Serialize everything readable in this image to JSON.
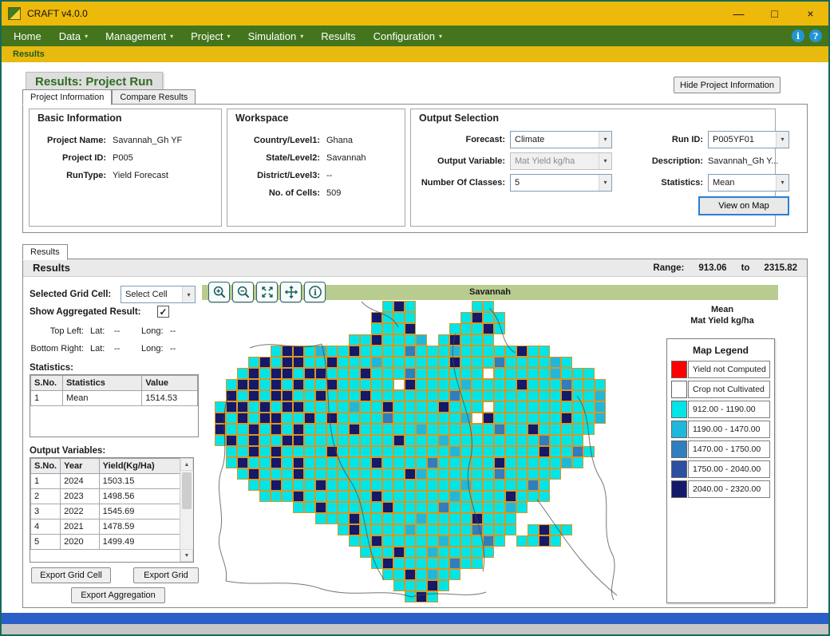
{
  "window": {
    "title": "CRAFT v4.0.0",
    "controls": {
      "minimize": "—",
      "maximize": "□",
      "close": "×"
    }
  },
  "icons": {
    "chevron_down": "▾",
    "scroll_up": "▲",
    "scroll_down": "▼",
    "check": "✓",
    "info": "i",
    "help": "?"
  },
  "menu": {
    "items": [
      {
        "label": "Home",
        "dropdown": false
      },
      {
        "label": "Data",
        "dropdown": true
      },
      {
        "label": "Management",
        "dropdown": true
      },
      {
        "label": "Project",
        "dropdown": true
      },
      {
        "label": "Simulation",
        "dropdown": true
      },
      {
        "label": "Results",
        "dropdown": false
      },
      {
        "label": "Configuration",
        "dropdown": true
      }
    ]
  },
  "breadcrumb": "Results",
  "page": {
    "title": "Results: Project Run",
    "hide_button": "Hide Project Information",
    "tabs": [
      {
        "label": "Project Information",
        "active": true
      },
      {
        "label": "Compare Results",
        "active": false
      }
    ]
  },
  "basic_information": {
    "title": "Basic Information",
    "fields": [
      {
        "label": "Project Name:",
        "value": "Savannah_Gh YF"
      },
      {
        "label": "Project ID:",
        "value": "P005"
      },
      {
        "label": "RunType:",
        "value": "Yield Forecast"
      }
    ]
  },
  "workspace": {
    "title": "Workspace",
    "fields": [
      {
        "label": "Country/Level1:",
        "value": "Ghana"
      },
      {
        "label": "State/Level2:",
        "value": "Savannah"
      },
      {
        "label": "District/Level3:",
        "value": "--"
      },
      {
        "label": "No. of Cells:",
        "value": "509"
      }
    ]
  },
  "output_selection": {
    "title": "Output Selection",
    "forecast_label": "Forecast:",
    "forecast_value": "Climate",
    "output_variable_label": "Output Variable:",
    "output_variable_value": "Mat Yield kg/ha",
    "classes_label": "Number Of Classes:",
    "classes_value": "5",
    "run_id_label": "Run ID:",
    "run_id_value": "P005YF01",
    "description_label": "Description:",
    "description_value": "Savannah_Gh Y...",
    "statistics_label": "Statistics:",
    "statistics_value": "Mean",
    "view_on_map": "View on Map"
  },
  "results": {
    "tab": "Results",
    "header": "Results",
    "range_label": "Range:",
    "range_min": "913.06",
    "range_to": "to",
    "range_max": "2315.82",
    "selected_grid_cell_label": "Selected Grid Cell:",
    "select_cell_value": "Select Cell",
    "toolbar": [
      "zoom-in",
      "zoom-out",
      "zoom-extent",
      "pan",
      "identify"
    ],
    "region_title": "Savannah",
    "aggregated_label": "Show Aggregated Result:",
    "aggregated_checked": true,
    "top_left_label": "Top Left:",
    "bottom_right_label": "Bottom Right:",
    "lat_label": "Lat:",
    "long_label": "Long:",
    "top_left_lat": "--",
    "top_left_long": "--",
    "bottom_right_lat": "--",
    "bottom_right_long": "--",
    "statistics_label": "Statistics:",
    "statistics_table": {
      "headers": [
        "S.No.",
        "Statistics",
        "Value"
      ],
      "rows": [
        [
          "1",
          "Mean",
          "1514.53"
        ]
      ]
    },
    "output_variables_label": "Output Variables:",
    "output_table": {
      "headers": [
        "S.No.",
        "Year",
        "Yield(Kg/Ha)"
      ],
      "rows": [
        [
          "1",
          "2024",
          "1503.15"
        ],
        [
          "2",
          "2023",
          "1498.56"
        ],
        [
          "3",
          "2022",
          "1545.69"
        ],
        [
          "4",
          "2021",
          "1478.59"
        ],
        [
          "5",
          "2020",
          "1499.49"
        ]
      ]
    },
    "export_grid_cell": "Export Grid Cell",
    "export_grid": "Export Grid",
    "export_aggregation": "Export Aggregation",
    "legend": {
      "stat_title": "Mean",
      "variable_title": "Mat Yield kg/ha",
      "title": "Map Legend",
      "entries": [
        {
          "color": "#FF0000",
          "label": "Yield not Computed"
        },
        {
          "color": "#FFFFFF",
          "label": "Crop not Cultivated"
        },
        {
          "color": "#00E5E8",
          "label": "912.00 - 1190.00"
        },
        {
          "color": "#1FB8DC",
          "label": "1190.00 - 1470.00"
        },
        {
          "color": "#2E7EC0",
          "label": "1470.00 - 1750.00"
        },
        {
          "color": "#2C4FA3",
          "label": "1750.00 - 2040.00"
        },
        {
          "color": "#14196B",
          "label": "2040.00 - 2320.00"
        }
      ]
    },
    "map": {
      "grid_line_color": "#D79822",
      "classes": {
        "a": "#00E5E8",
        "b": "#1FB8DC",
        "c": "#2E7EC0",
        "d": "#2C4FA3",
        "e": "#14196B",
        "w": "#FFFFFF"
      },
      "rows": [
        "                aea     aa",
        "               eaaa    aeaa",
        "               aaae   aaaea",
        "             aaeaaab aeaaa",
        "      aeeabaaeaaaacaaabaaaaaeaa",
        "    aeaeeaaeaaabaaaaaaeaaacaaaaba",
        "   aeaeeaeeaaaeaaacaaaaaawaaaaabaaa",
        "  aeeaeaeaaeaaaaaweaaaabaaaaeaaacaaa",
        "  eaeaeeaaeaaaeaaaaaaacaaaaaaaaaeaab",
        " aeeaeaeeaaaabaaeaaaaeaaawaaaaaaaaab",
        " eaeaeeaaeaeaaaacaaaaaabweaaaaaaeaab",
        " eaaeaeaeaaaaeaaaaabaaaaaacaaeaaaaa",
        " aeaeaaeeaaaaaaaaeaaabaaaaaaaacaaa",
        "  aaeaeaaaaeaaaaaaaaaabaaaaaaaeaaca",
        "  aeaaeaeaaaaaaeaaaacaaaaaeaaaaaba",
        "   aeaaaeaaaaaaaaaebaaaaaacaaaaa",
        "    aaeaaaeaaaaaaaaaaaabaaaaaca",
        "     aaaeaaaaaaeaaaaaabaaaaeaaa",
        "        aaeaaaaaeaaaacaaaaaba",
        "          aaaeaaaaabaaaaeaaa",
        "            aeaaaabaaaaacaaa aeaa",
        "             aaeaaaaabaaaca aaea",
        "              aaaeaabaaaaa",
        "               aeaaaaacaa",
        "                aaeabaa",
        "                 aaaea",
        "                  aea"
      ]
    }
  }
}
